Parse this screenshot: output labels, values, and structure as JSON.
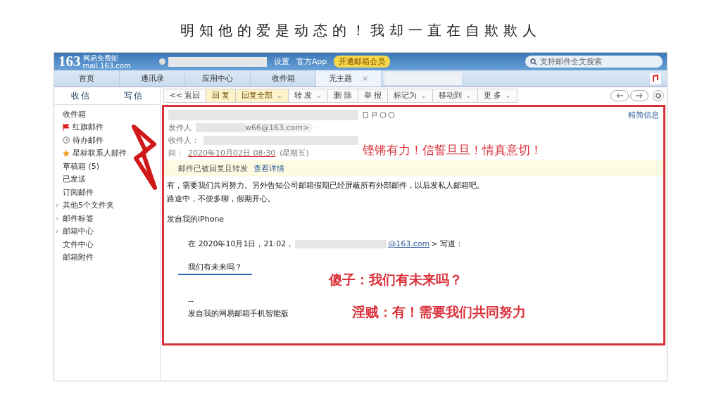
{
  "slide_title": "明知他的爱是动态的！我却一直在自欺欺人",
  "logo": {
    "number": "163",
    "name": "网易免费邮",
    "domain": "mail.163.com"
  },
  "top_links": [
    "设置",
    "官方App"
  ],
  "vip_badge": "开通邮箱会员",
  "search": {
    "placeholder": "支持邮件全文搜索"
  },
  "tabs": [
    {
      "label": "首页",
      "selected": false
    },
    {
      "label": "通讯录",
      "selected": false
    },
    {
      "label": "应用中心",
      "selected": false
    },
    {
      "label": "收件箱",
      "selected": false
    },
    {
      "label": "无主题",
      "selected": true,
      "close": "×"
    }
  ],
  "receive_button": "收信",
  "compose_button": "写信",
  "toolbar": [
    {
      "label": "<< 返回",
      "highlight": false
    },
    {
      "label": "回 复",
      "highlight": true
    },
    {
      "label": "回复全部",
      "highlight": true,
      "caret": "⌄"
    },
    {
      "label": "转 发",
      "highlight": false,
      "caret": "⌄"
    },
    {
      "label": "删 除",
      "highlight": false
    },
    {
      "label": "举 报",
      "highlight": false
    },
    {
      "label": "标记为",
      "highlight": false,
      "caret": "⌄"
    },
    {
      "label": "移动到",
      "highlight": false,
      "caret": "⌄"
    },
    {
      "label": "更 多",
      "highlight": false,
      "caret": "⌄"
    }
  ],
  "sidebar": [
    {
      "label": "收件箱",
      "kind": "plain"
    },
    {
      "label": "红旗邮件",
      "kind": "flag"
    },
    {
      "label": "待办邮件",
      "kind": "clock"
    },
    {
      "label": "星标联系人邮件",
      "kind": "star"
    },
    {
      "label": "草稿箱 (5)",
      "kind": "plain"
    },
    {
      "label": "已发送",
      "kind": "plain"
    },
    {
      "label": "订阅邮件",
      "kind": "plain"
    },
    {
      "label": "其他5个文件夹",
      "kind": "plain",
      "chevron": "›"
    },
    {
      "label": "邮件标签",
      "kind": "plain",
      "chevron": "›"
    },
    {
      "label": "邮箱中心",
      "kind": "plain",
      "chevron": "›"
    },
    {
      "label": "文件中心",
      "kind": "plain"
    },
    {
      "label": "邮箱附件",
      "kind": "plain"
    }
  ],
  "header": {
    "summary_link": "精简信息",
    "sender_label": "发件人",
    "sender_address": "w66@163.com>",
    "recipient_label": "收件人：",
    "time_label": "间：",
    "time": "2020年10月02日 08:30",
    "weekday": "(星期五)"
  },
  "notice": {
    "text": "邮件已被回复且转发",
    "link": "查看详情"
  },
  "body": {
    "lines": [
      "有，需要我们共同努力。另外告知公司邮箱假期已经屏蔽所有外部邮件，以后发私人邮箱吧。",
      "路途中，不便多聊，假期开心。"
    ],
    "signature": "发自我的iPhone",
    "quote_intro": "在 2020年10月1日，21:02，",
    "quote_address": "@163.com",
    "quote_tail": "> 写道：",
    "quote_text": "我们有未来吗？",
    "dashes": "--",
    "footer": "发自我的网易邮箱手机智能版"
  },
  "annotations": [
    "铿锵有力！信誓旦旦！情真意切！",
    "傻子：我们有未来吗？",
    "淫贼：有！需要我们共同努力"
  ]
}
